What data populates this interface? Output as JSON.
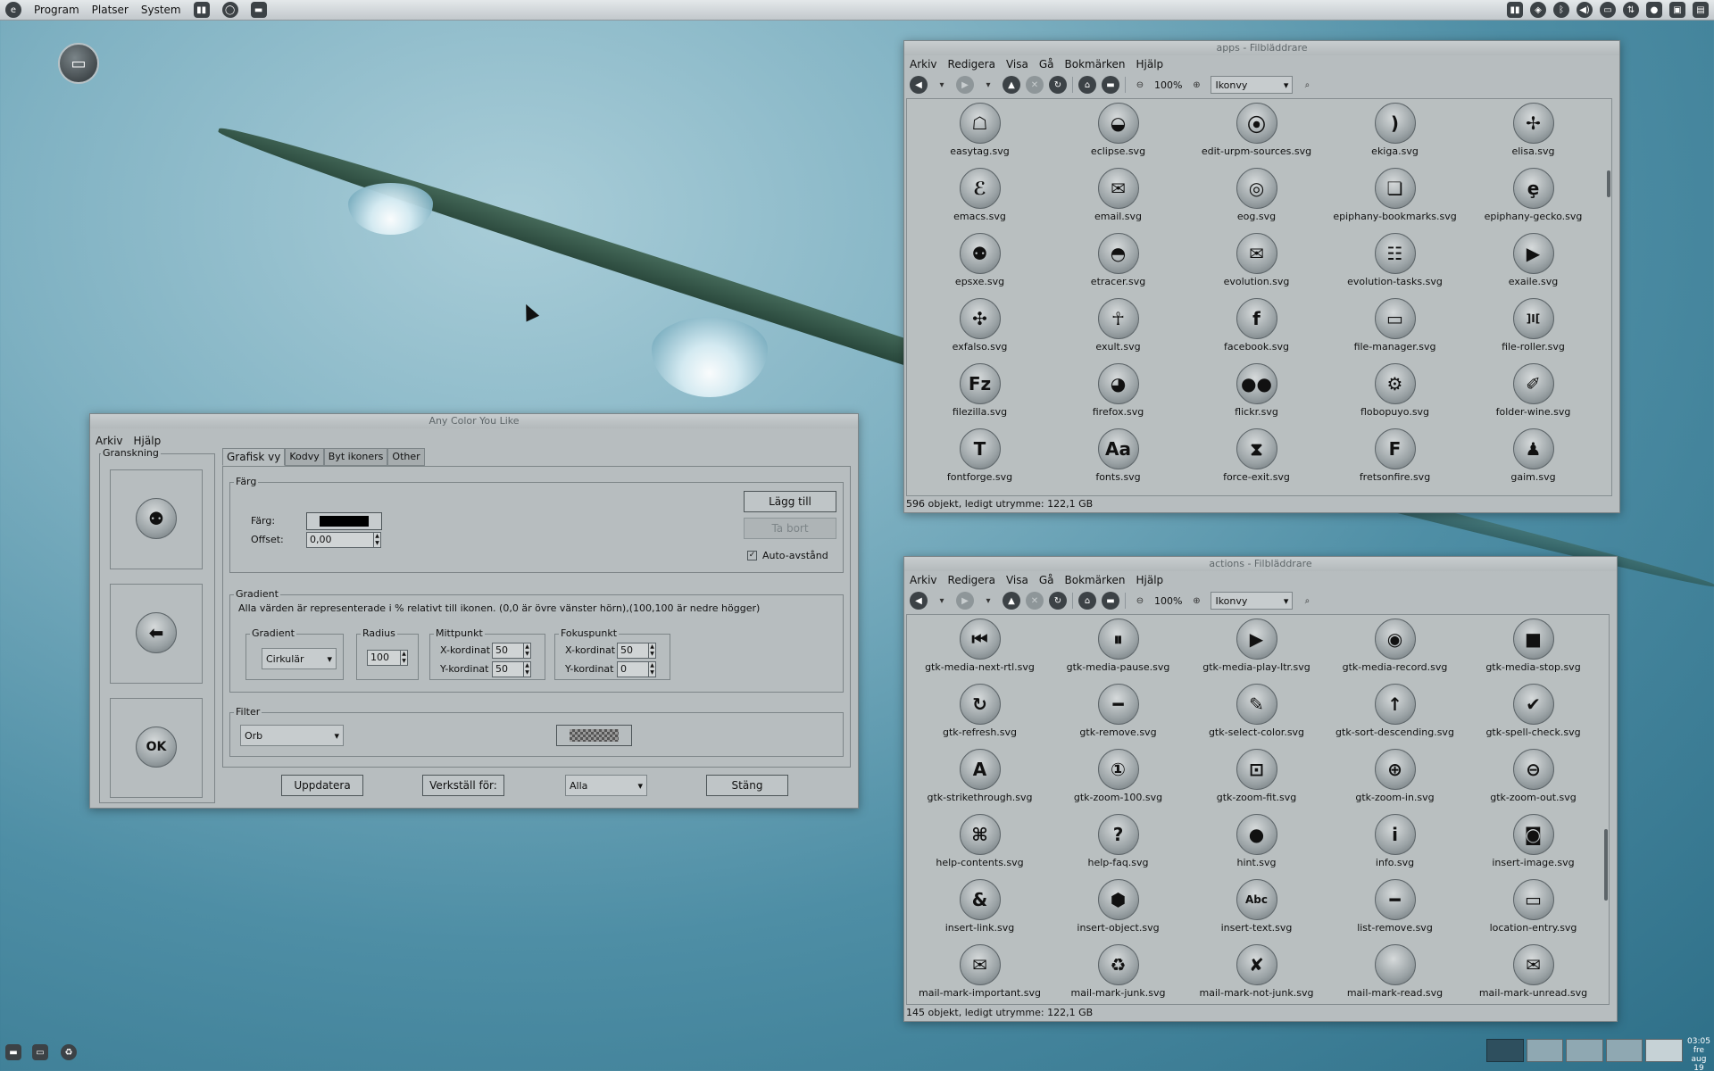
{
  "top_panel": {
    "menus": [
      "Program",
      "Platser",
      "System"
    ],
    "clock_time": "03:05",
    "clock_date": "fre aug 19"
  },
  "colors": {
    "panel": "#c8cdcf",
    "window": "#b7bdbf",
    "orb_dark": "#3c4246"
  },
  "apps_window": {
    "title": "apps - Filbläddrare",
    "menu": [
      "Arkiv",
      "Redigera",
      "Visa",
      "Gå",
      "Bokmärken",
      "Hjälp"
    ],
    "zoom": "100%",
    "view_mode": "Ikonvy",
    "items": [
      {
        "label": "easytag.svg",
        "icon": "tag-icon",
        "glyph": "☖"
      },
      {
        "label": "eclipse.svg",
        "icon": "eclipse-icon",
        "glyph": "◒"
      },
      {
        "label": "edit-urpm-sources.svg",
        "icon": "sources-icon",
        "glyph": "⦿"
      },
      {
        "label": "ekiga.svg",
        "icon": "phone-icon",
        "glyph": ")"
      },
      {
        "label": "elisa.svg",
        "icon": "elisa-icon",
        "glyph": "✢"
      },
      {
        "label": "emacs.svg",
        "icon": "emacs-icon",
        "glyph": "ℰ"
      },
      {
        "label": "email.svg",
        "icon": "mailbox-icon",
        "glyph": "✉"
      },
      {
        "label": "eog.svg",
        "icon": "eye-of-gnome-icon",
        "glyph": "◎"
      },
      {
        "label": "epiphany-bookmarks.svg",
        "icon": "bookmark-icon",
        "glyph": "❏"
      },
      {
        "label": "epiphany-gecko.svg",
        "icon": "footprint-icon",
        "glyph": "ȩ"
      },
      {
        "label": "epsxe.svg",
        "icon": "gamepad-icon",
        "glyph": "⚉"
      },
      {
        "label": "etracer.svg",
        "icon": "fish-icon",
        "glyph": "◓"
      },
      {
        "label": "evolution.svg",
        "icon": "envelope-icon",
        "glyph": "✉"
      },
      {
        "label": "evolution-tasks.svg",
        "icon": "tasks-icon",
        "glyph": "☷"
      },
      {
        "label": "exaile.svg",
        "icon": "play-icon",
        "glyph": "▶"
      },
      {
        "label": "exfalso.svg",
        "icon": "flower-icon",
        "glyph": "✣"
      },
      {
        "label": "exult.svg",
        "icon": "ankh-icon",
        "glyph": "☥"
      },
      {
        "label": "facebook.svg",
        "icon": "facebook-icon",
        "glyph": "f"
      },
      {
        "label": "file-manager.svg",
        "icon": "folder-icon",
        "glyph": "▭"
      },
      {
        "label": "file-roller.svg",
        "icon": "archive-icon",
        "glyph": "]I["
      },
      {
        "label": "filezilla.svg",
        "icon": "filezilla-icon",
        "glyph": "Fz"
      },
      {
        "label": "firefox.svg",
        "icon": "firefox-icon",
        "glyph": "◕"
      },
      {
        "label": "flickr.svg",
        "icon": "flickr-icon",
        "glyph": "●●"
      },
      {
        "label": "flobopuyo.svg",
        "icon": "gear-icon",
        "glyph": "⚙"
      },
      {
        "label": "folder-wine.svg",
        "icon": "wine-icon",
        "glyph": "✐"
      },
      {
        "label": "fontforge.svg",
        "icon": "fontforge-icon",
        "glyph": "T"
      },
      {
        "label": "fonts.svg",
        "icon": "fonts-icon",
        "glyph": "Aa"
      },
      {
        "label": "force-exit.svg",
        "icon": "force-exit-icon",
        "glyph": "⧗"
      },
      {
        "label": "fretsonfire.svg",
        "icon": "fretsonfire-icon",
        "glyph": "F"
      },
      {
        "label": "gaim.svg",
        "icon": "person-icon",
        "glyph": "♟"
      }
    ],
    "status": "596 objekt, ledigt utrymme: 122,1 GB"
  },
  "actions_window": {
    "title": "actions - Filbläddrare",
    "menu": [
      "Arkiv",
      "Redigera",
      "Visa",
      "Gå",
      "Bokmärken",
      "Hjälp"
    ],
    "zoom": "100%",
    "view_mode": "Ikonvy",
    "items": [
      {
        "label": "gtk-media-next-rtl.svg",
        "icon": "media-next-rtl-icon",
        "glyph": "⏮"
      },
      {
        "label": "gtk-media-pause.svg",
        "icon": "media-pause-icon",
        "glyph": "⏸"
      },
      {
        "label": "gtk-media-play-ltr.svg",
        "icon": "media-play-icon",
        "glyph": "▶"
      },
      {
        "label": "gtk-media-record.svg",
        "icon": "media-record-icon",
        "glyph": "◉"
      },
      {
        "label": "gtk-media-stop.svg",
        "icon": "media-stop-icon",
        "glyph": "■"
      },
      {
        "label": "gtk-refresh.svg",
        "icon": "refresh-icon",
        "glyph": "↻"
      },
      {
        "label": "gtk-remove.svg",
        "icon": "remove-icon",
        "glyph": "━"
      },
      {
        "label": "gtk-select-color.svg",
        "icon": "palette-icon",
        "glyph": "✎"
      },
      {
        "label": "gtk-sort-descending.svg",
        "icon": "sort-descending-icon",
        "glyph": "↑"
      },
      {
        "label": "gtk-spell-check.svg",
        "icon": "spell-check-icon",
        "glyph": "✔"
      },
      {
        "label": "gtk-strikethrough.svg",
        "icon": "strikethrough-icon",
        "glyph": "A"
      },
      {
        "label": "gtk-zoom-100.svg",
        "icon": "zoom-100-icon",
        "glyph": "①"
      },
      {
        "label": "gtk-zoom-fit.svg",
        "icon": "zoom-fit-icon",
        "glyph": "⊡"
      },
      {
        "label": "gtk-zoom-in.svg",
        "icon": "zoom-in-icon",
        "glyph": "⊕"
      },
      {
        "label": "gtk-zoom-out.svg",
        "icon": "zoom-out-icon",
        "glyph": "⊖"
      },
      {
        "label": "help-contents.svg",
        "icon": "help-contents-icon",
        "glyph": "⌘"
      },
      {
        "label": "help-faq.svg",
        "icon": "help-faq-icon",
        "glyph": "?"
      },
      {
        "label": "hint.svg",
        "icon": "lightbulb-icon",
        "glyph": "●"
      },
      {
        "label": "info.svg",
        "icon": "info-icon",
        "glyph": "i"
      },
      {
        "label": "insert-image.svg",
        "icon": "camera-icon",
        "glyph": "◙"
      },
      {
        "label": "insert-link.svg",
        "icon": "link-icon",
        "glyph": "&"
      },
      {
        "label": "insert-object.svg",
        "icon": "object-icon",
        "glyph": "⬢"
      },
      {
        "label": "insert-text.svg",
        "icon": "text-icon",
        "glyph": "Abc"
      },
      {
        "label": "list-remove.svg",
        "icon": "list-remove-icon",
        "glyph": "━"
      },
      {
        "label": "location-entry.svg",
        "icon": "location-entry-icon",
        "glyph": "▭"
      },
      {
        "label": "mail-mark-important.svg",
        "icon": "mail-important-icon",
        "glyph": "✉"
      },
      {
        "label": "mail-mark-junk.svg",
        "icon": "recycle-icon",
        "glyph": "♻"
      },
      {
        "label": "mail-mark-not-junk.svg",
        "icon": "mail-not-junk-icon",
        "glyph": "✘"
      },
      {
        "label": "mail-mark-read.svg",
        "icon": "mail-read-icon",
        "glyph": ""
      },
      {
        "label": "mail-mark-unread.svg",
        "icon": "mail-unread-icon",
        "glyph": "✉"
      }
    ],
    "status": "145 objekt, ledigt utrymme: 122,1 GB"
  },
  "acyl": {
    "title": "Any Color You Like",
    "menu": [
      "Arkiv",
      "Hjälp"
    ],
    "preview_label": "Granskning",
    "tabs": [
      "Grafisk vy",
      "Kodvy",
      "Byt ikoners",
      "Other"
    ],
    "color_group": "Färg",
    "color_label": "Färg:",
    "offset_label": "Offset:",
    "offset_value": "0,00",
    "add_button": "Lägg till",
    "remove_button": "Ta bort",
    "auto_spacing": "Auto-avstånd",
    "gradient_group": "Gradient",
    "gradient_note": "Alla värden är representerade i % relativt till ikonen. (0,0 är övre vänster hörn),(100,100 är nedre högger)",
    "gradient_type_label": "Gradient",
    "gradient_type": "Cirkulär",
    "radius_label": "Radius",
    "radius_value": "100",
    "midpoint_label": "Mittpunkt",
    "focus_label": "Fokuspunkt",
    "x_label": "X-kordinat",
    "y_label": "Y-kordinat",
    "mid_x": "50",
    "mid_y": "50",
    "focus_x": "50",
    "focus_y": "0",
    "filter_group": "Filter",
    "filter_value": "Orb",
    "update_button": "Uppdatera",
    "apply_button": "Verkställ för:",
    "apply_target": "Alla",
    "close_button": "Stäng"
  }
}
